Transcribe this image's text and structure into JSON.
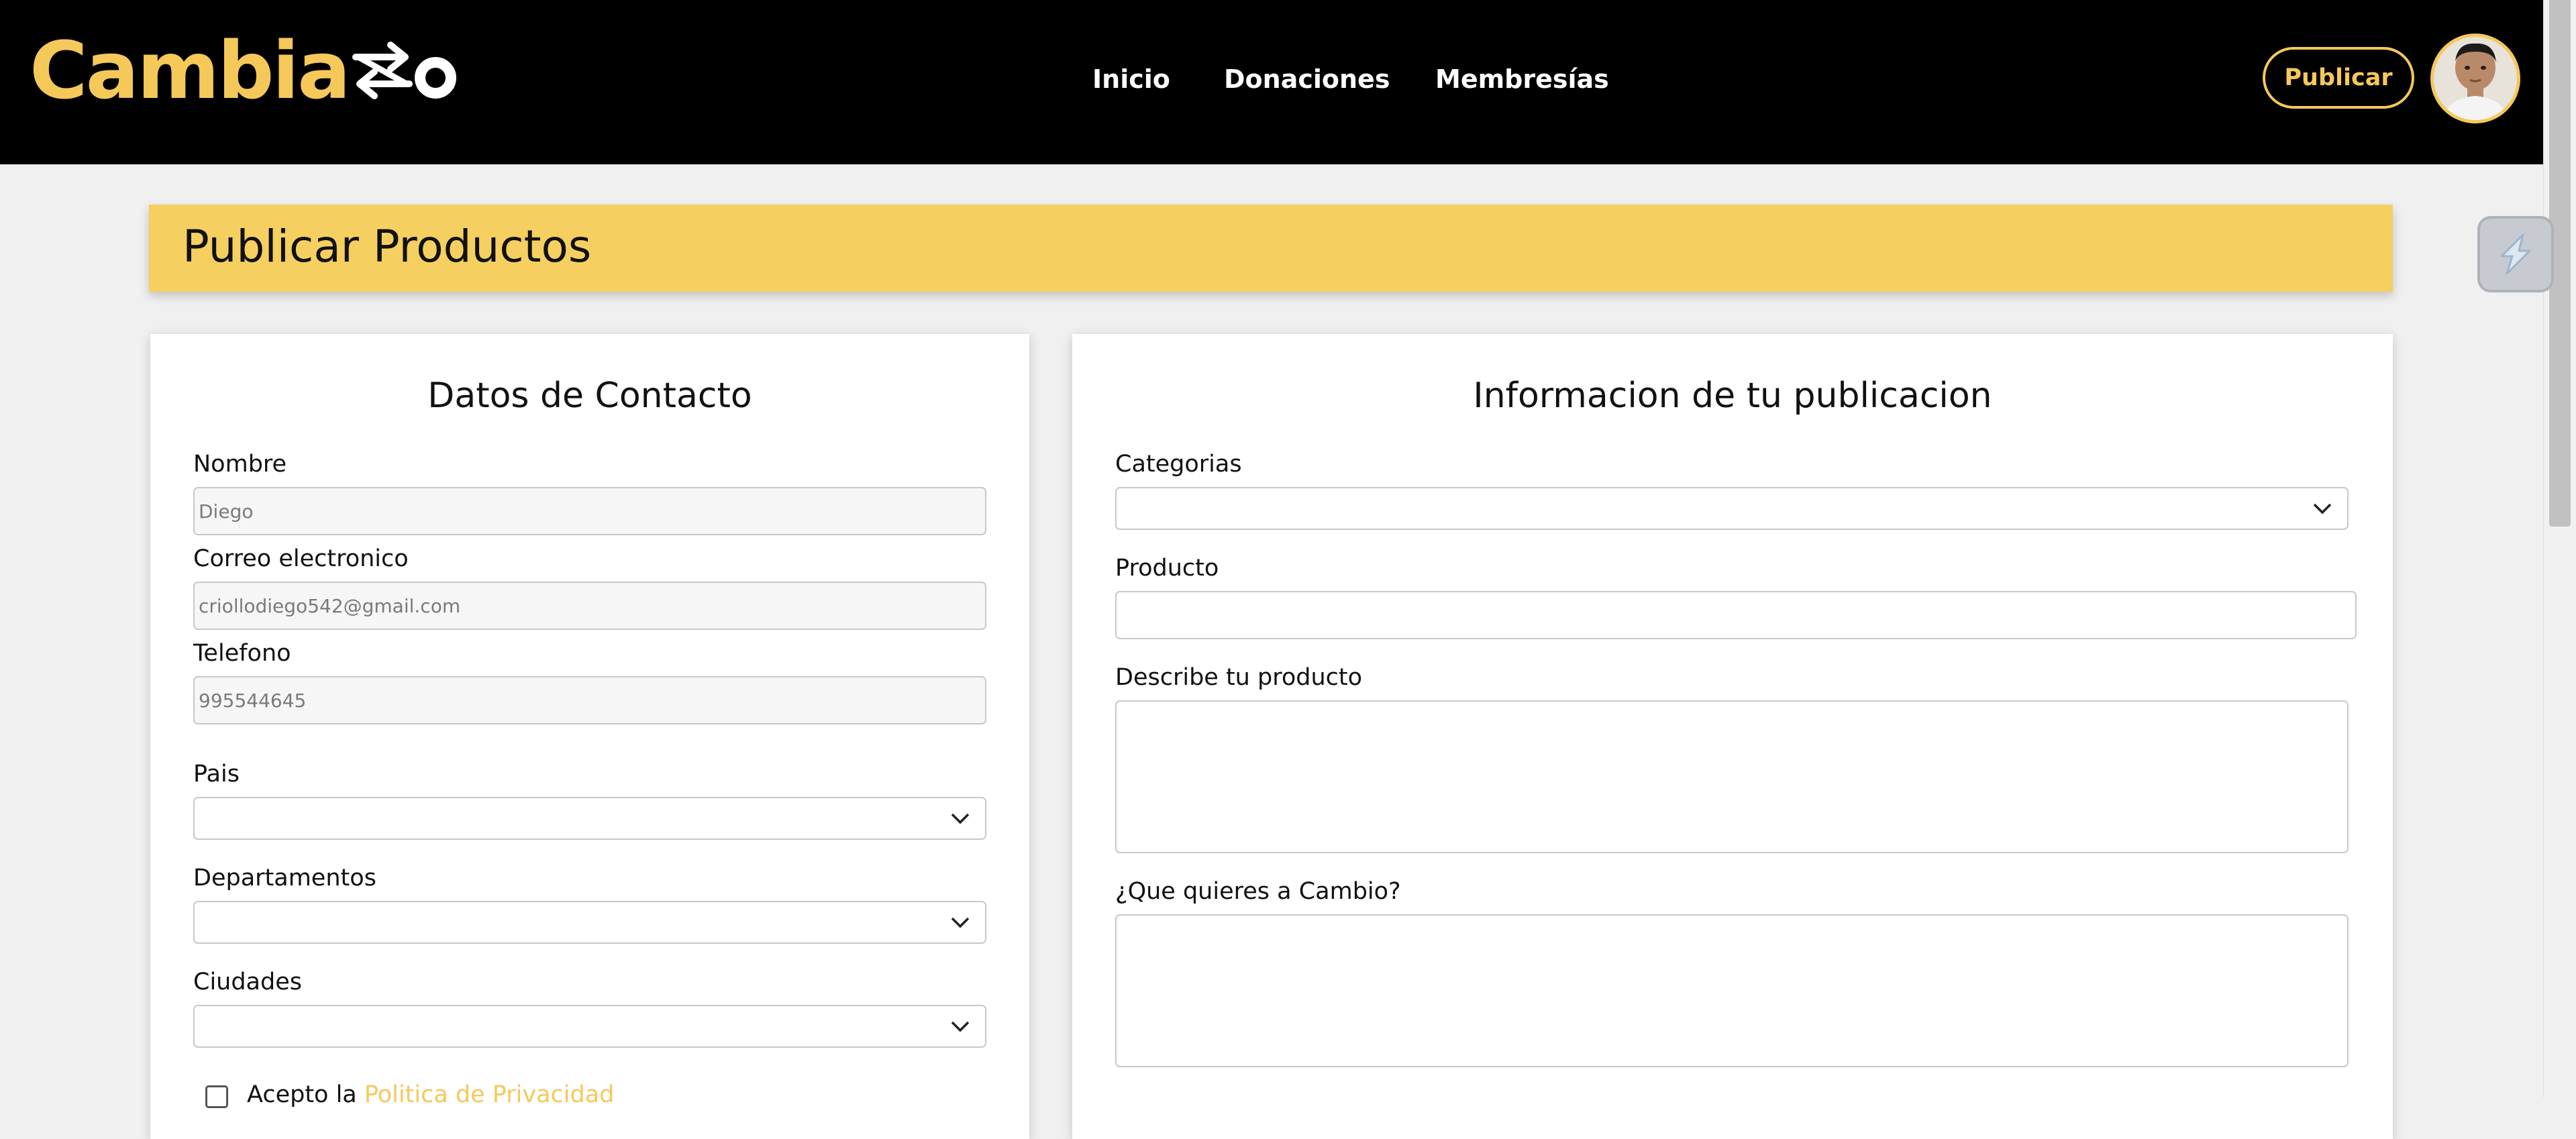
{
  "header": {
    "logo_text": "Cambia",
    "logo_full": "Cambiazo",
    "nav": [
      "Inicio",
      "Donaciones",
      "Membresías"
    ],
    "publish_button": "Publicar",
    "brand_color": "#f5c85a",
    "avatar_icon": "user-avatar"
  },
  "page": {
    "title": "Publicar Productos"
  },
  "contact": {
    "title": "Datos de Contacto",
    "name_label": "Nombre",
    "name_value": "Diego",
    "email_label": "Correo electronico",
    "email_value": "criollodiego542@gmail.com",
    "phone_label": "Telefono",
    "phone_value": "995544645",
    "country_label": "Pais",
    "department_label": "Departamentos",
    "city_label": "Ciudades",
    "accept_prefix": "Acepto la",
    "accept_link": "Politica de Privacidad"
  },
  "publication": {
    "title": "Informacion de tu publicacion",
    "categories_label": "Categorias",
    "product_label": "Producto",
    "describe_label": "Describe tu producto",
    "exchange_label": "¿Que quieres a Cambio?"
  }
}
